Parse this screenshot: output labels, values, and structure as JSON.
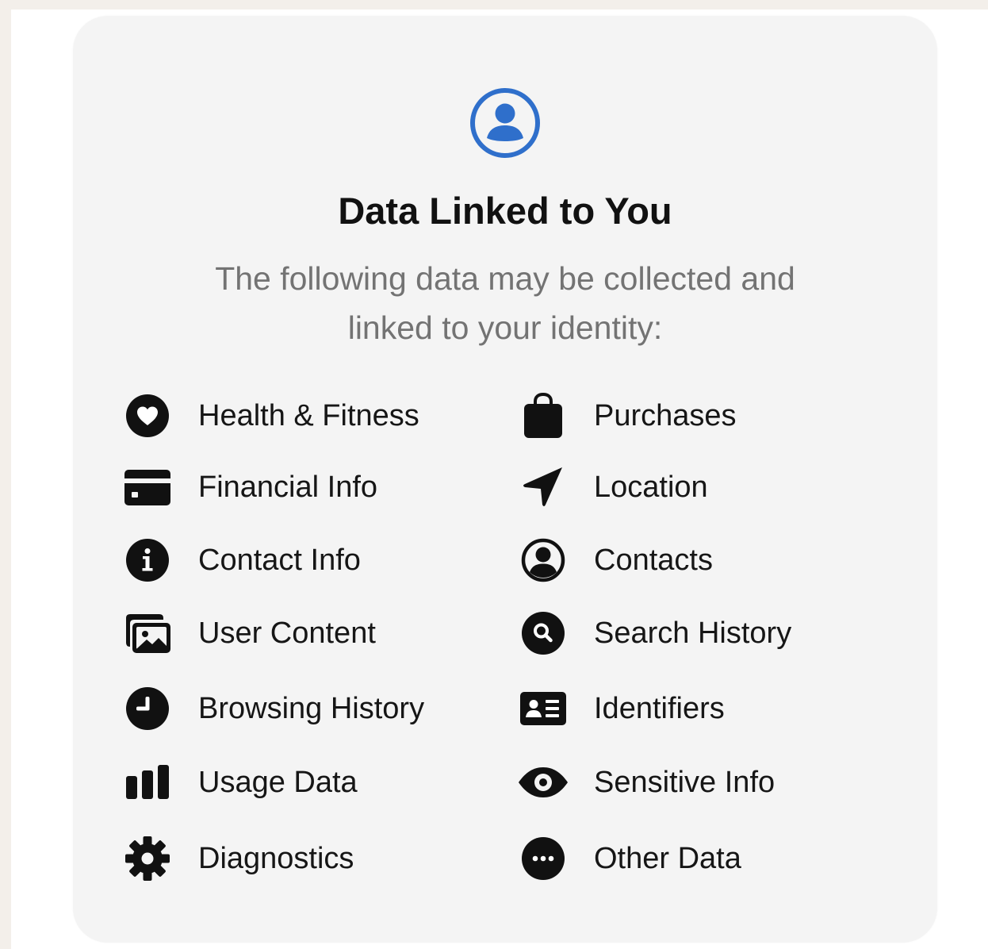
{
  "header": {
    "icon": "person-circle-icon",
    "title": "Data Linked to You",
    "subtitle_line1": "The following data may be collected and",
    "subtitle_line2": "linked to your identity:"
  },
  "colors": {
    "accent": "#2f6fcb",
    "text": "#161616",
    "subtitle": "#737373",
    "card": "#f4f4f4"
  },
  "left_column": [
    {
      "label": "Health & Fitness",
      "icon": "heart-icon"
    },
    {
      "label": "Financial Info",
      "icon": "credit-card-icon"
    },
    {
      "label": "Contact Info",
      "icon": "info-icon"
    },
    {
      "label": "User Content",
      "icon": "photos-icon"
    },
    {
      "label": "Browsing History",
      "icon": "clock-icon"
    },
    {
      "label": "Usage Data",
      "icon": "bar-chart-icon"
    },
    {
      "label": "Diagnostics",
      "icon": "gear-icon"
    }
  ],
  "right_column": [
    {
      "label": "Purchases",
      "icon": "shopping-bag-icon"
    },
    {
      "label": "Location",
      "icon": "location-arrow-icon"
    },
    {
      "label": "Contacts",
      "icon": "person-circle-icon"
    },
    {
      "label": "Search History",
      "icon": "search-icon"
    },
    {
      "label": "Identifiers",
      "icon": "id-card-icon"
    },
    {
      "label": "Sensitive Info",
      "icon": "eye-icon"
    },
    {
      "label": "Other Data",
      "icon": "ellipsis-icon"
    }
  ]
}
